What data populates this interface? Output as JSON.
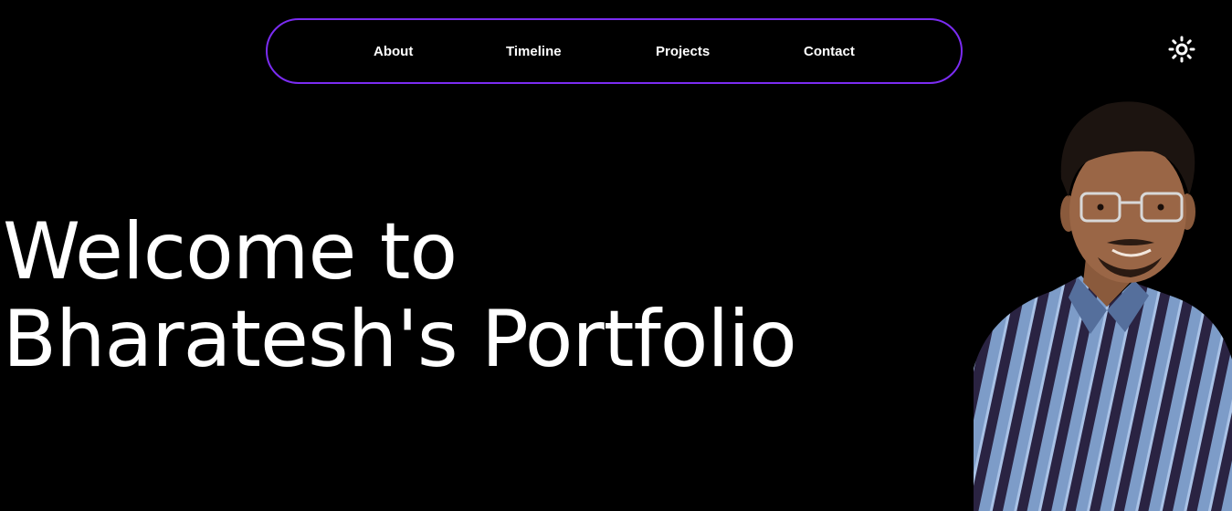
{
  "nav": {
    "items": [
      {
        "label": "About"
      },
      {
        "label": "Timeline"
      },
      {
        "label": "Projects"
      },
      {
        "label": "Contact"
      }
    ],
    "border_color": "#7b2cf2"
  },
  "theme_toggle": {
    "icon": "sun-icon"
  },
  "hero": {
    "title_line1": "Welcome to",
    "title_line2": "Bharatesh's Portfolio"
  },
  "portrait": {
    "icon": "person-photo"
  },
  "colors": {
    "background": "#000000",
    "text": "#ffffff",
    "accent": "#7b2cf2"
  }
}
